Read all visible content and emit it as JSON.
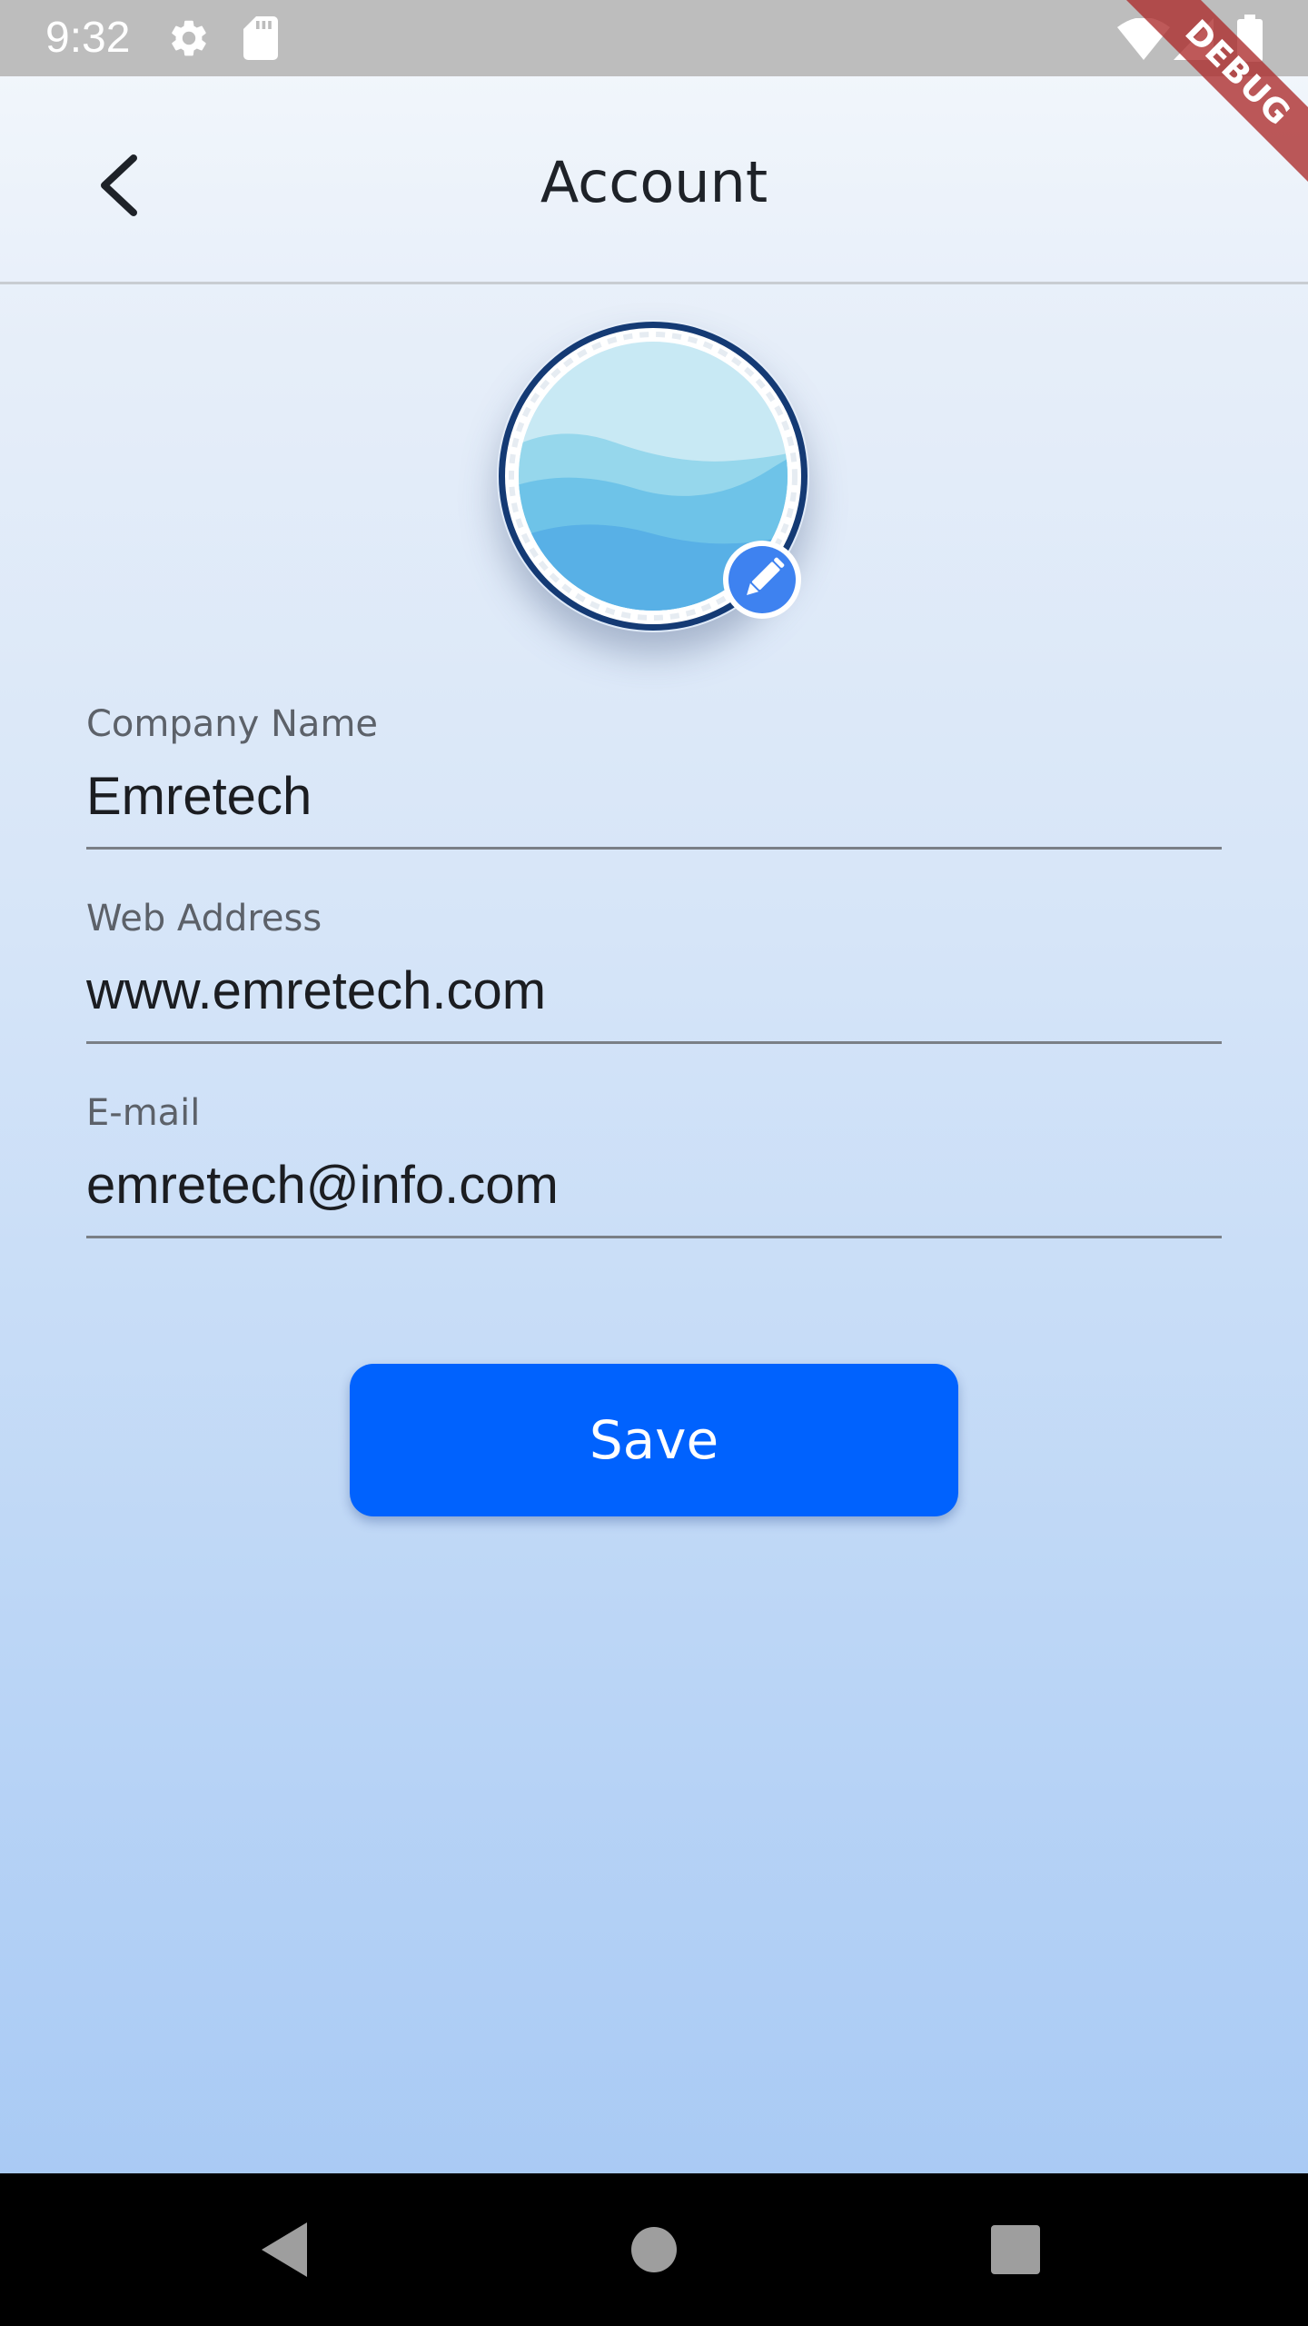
{
  "status_bar": {
    "time": "9:32",
    "icons": [
      "gear-icon",
      "sd-card-icon",
      "wifi-icon",
      "signal-icon",
      "battery-icon"
    ],
    "color": "#bdbdbd"
  },
  "debug_banner": {
    "label": "DEBUG",
    "color": "#ac2a2a"
  },
  "app_bar": {
    "title": "Account",
    "back_icon": "chevron-left-icon"
  },
  "avatar": {
    "image": "waves-logo",
    "edit_icon": "pencil-icon",
    "ring_color": "#143a74",
    "badge_color": "#3e82f0"
  },
  "form": {
    "fields": [
      {
        "label": "Company Name",
        "value": "Emretech"
      },
      {
        "label": "Web Address",
        "value": "www.emretech.com"
      },
      {
        "label": "E-mail",
        "value": "emretech@info.com"
      }
    ]
  },
  "actions": {
    "save_label": "Save",
    "save_color": "#0062fe"
  },
  "nav_bar": {
    "icons": [
      "nav-back-icon",
      "nav-home-icon",
      "nav-recents-icon"
    ]
  }
}
